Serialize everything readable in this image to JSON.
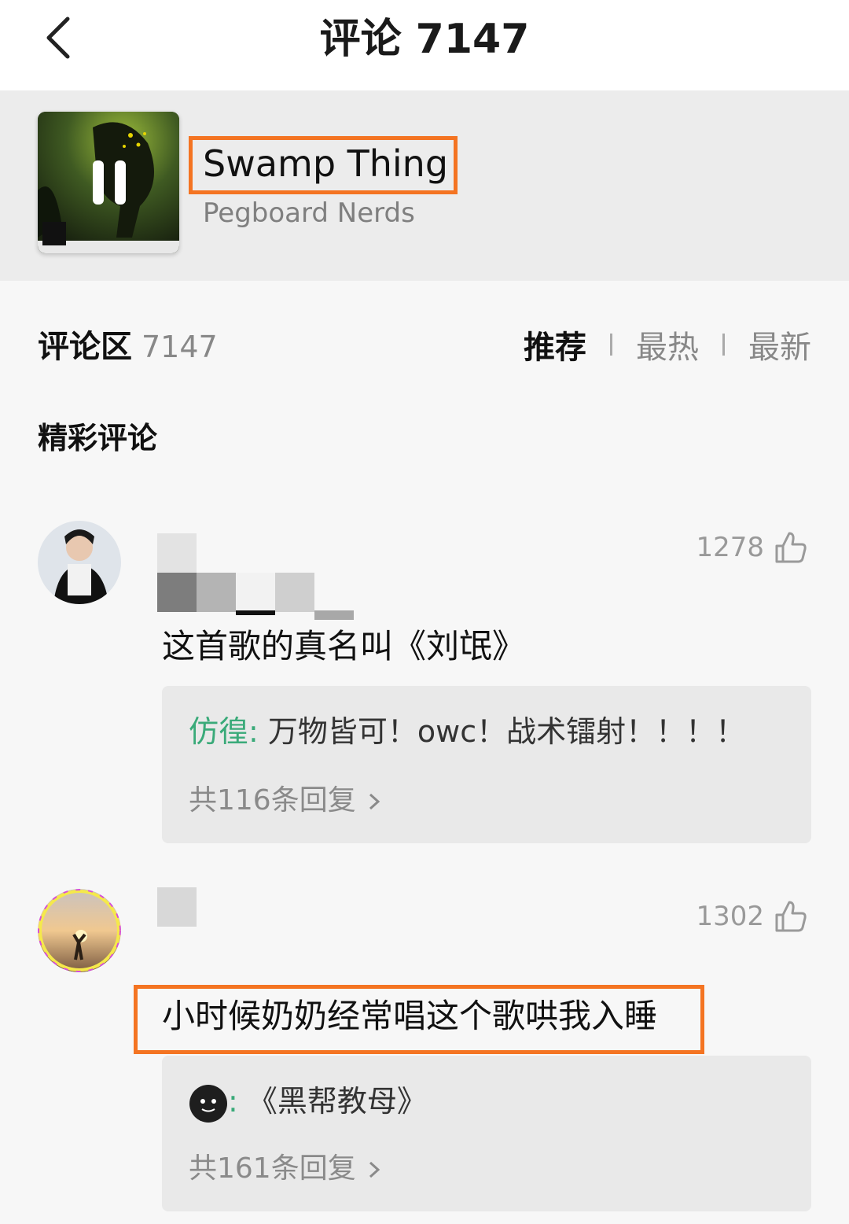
{
  "header": {
    "title": "评论 7147",
    "back_icon": "chevron-left-icon"
  },
  "song": {
    "title": "Swamp Thing",
    "artist": "Pegboard Nerds",
    "cover_state_icon": "pause-icon"
  },
  "comments_section": {
    "label": "评论区",
    "count": "7147",
    "sort_tabs": [
      {
        "label": "推荐",
        "active": true
      },
      {
        "label": "最热",
        "active": false
      },
      {
        "label": "最新",
        "active": false
      }
    ],
    "featured_label": "精彩评论"
  },
  "comments": [
    {
      "likes": "1278",
      "text": "这首歌的真名叫《刘氓》",
      "reply": {
        "author": "仿徨",
        "separator": ":",
        "text": " 万物皆可！owc！战术镭射！！！！",
        "more": "共116条回复"
      }
    },
    {
      "likes": "1302",
      "text": "小时候奶奶经常唱这个歌哄我入睡",
      "reply": {
        "author": "",
        "separator": ":",
        "text": " 《黑帮教母》",
        "more": "共161条回复"
      }
    }
  ],
  "colors": {
    "accent_orange": "#f47422",
    "reply_name_green": "#3aaa79"
  }
}
